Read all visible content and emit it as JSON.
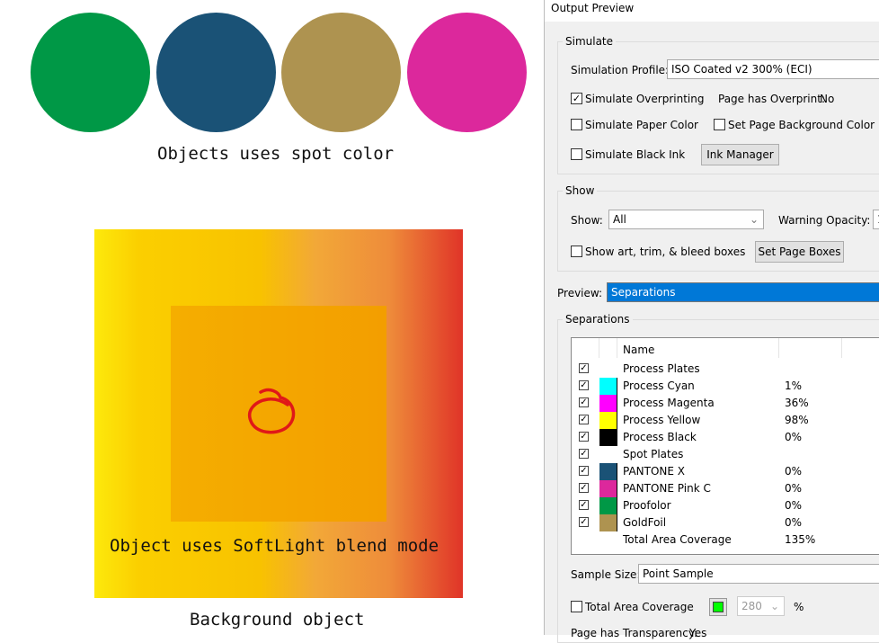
{
  "canvas": {
    "spot_circles": [
      {
        "name": "Proofolor",
        "color": "#009846"
      },
      {
        "name": "PANTONE X",
        "color": "#1a5276"
      },
      {
        "name": "GoldFoil",
        "color": "#ae9350"
      },
      {
        "name": "PANTONE Pink C",
        "color": "#dc289c"
      }
    ],
    "spot_caption": "Objects uses spot color",
    "softlight_caption": "Object uses SoftLight blend mode",
    "background_caption": "Background object"
  },
  "panel": {
    "title": "Output Preview",
    "simulate": {
      "legend": "Simulate",
      "profile_label": "Simulation Profile:",
      "profile_value": "ISO Coated v2 300% (ECI)",
      "overprinting_label": "Simulate Overprinting",
      "overprinting_checked": true,
      "page_overprint_label": "Page has Overprint:",
      "page_overprint_value": "No",
      "paper_color_label": "Simulate Paper Color",
      "page_bg_label": "Set Page Background Color",
      "black_ink_label": "Simulate Black Ink",
      "ink_manager": "Ink Manager"
    },
    "show": {
      "legend": "Show",
      "show_label": "Show:",
      "show_value": "All",
      "warning_opacity_label": "Warning Opacity:",
      "warning_opacity_value": "1",
      "boxes_label": "Show art, trim, & bleed boxes",
      "set_page_boxes": "Set Page Boxes"
    },
    "preview": {
      "label": "Preview:",
      "value": "Separations"
    },
    "separations": {
      "legend": "Separations",
      "column_name": "Name",
      "rows": [
        {
          "name": "Process Plates",
          "value": "",
          "color": null
        },
        {
          "name": "Process Cyan",
          "value": "1%",
          "color": "#00ffff"
        },
        {
          "name": "Process Magenta",
          "value": "36%",
          "color": "#ff00ff"
        },
        {
          "name": "Process Yellow",
          "value": "98%",
          "color": "#ffff00"
        },
        {
          "name": "Process Black",
          "value": "0%",
          "color": "#000000"
        },
        {
          "name": "Spot Plates",
          "value": "",
          "color": null
        },
        {
          "name": "PANTONE X",
          "value": "0%",
          "color": "#1a5276"
        },
        {
          "name": "PANTONE Pink C",
          "value": "0%",
          "color": "#dc289c"
        },
        {
          "name": "Proofolor",
          "value": "0%",
          "color": "#009846"
        },
        {
          "name": "GoldFoil",
          "value": "0%",
          "color": "#ae9350"
        }
      ],
      "total_label": "Total Area Coverage",
      "total_value": "135%",
      "sample_size_label": "Sample Size:",
      "sample_size_value": "Point Sample",
      "tac_label": "Total Area Coverage",
      "tac_value": "280",
      "tac_unit": "%",
      "tac_color": "#00ff00",
      "transparency_label": "Page has Transparency:",
      "transparency_value": "Yes"
    }
  }
}
